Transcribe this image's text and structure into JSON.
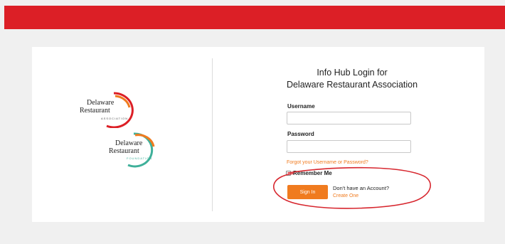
{
  "login": {
    "title_line1": "Info Hub Login for",
    "title_line2": "Delaware Restaurant Association",
    "username_label": "Username",
    "username_value": "",
    "password_label": "Password",
    "password_value": "",
    "forgot_link": "Forgot your Username or Password?",
    "remember_label": "Remember Me",
    "remember_checked": false,
    "signin_label": "Sign In",
    "no_account_text": "Don't have an Account?",
    "create_link": "Create One"
  },
  "logos": {
    "association": {
      "line1": "Delaware",
      "line2": "Restaurant",
      "sub": "ASSOCIATION"
    },
    "foundation": {
      "line1": "Delaware",
      "line2": "Restaurant",
      "sub": "FOUNDATION"
    }
  },
  "colors": {
    "header_red": "#dc1f26",
    "accent_orange": "#f07b1f",
    "annotation_red": "#d7262e",
    "foundation_teal": "#3fb09a"
  },
  "icons": {
    "association_logo": "association-logo-icon",
    "foundation_logo": "foundation-logo-icon"
  }
}
